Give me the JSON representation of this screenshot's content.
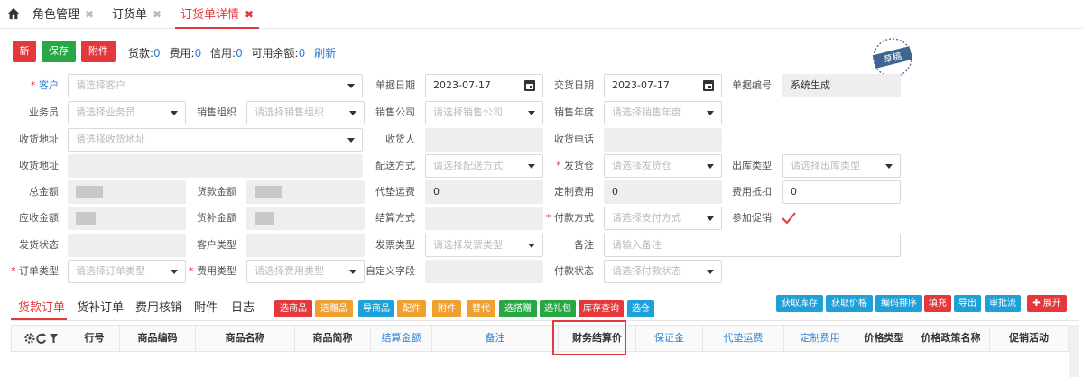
{
  "tabs": [
    {
      "label": "角色管理",
      "close": "✖",
      "active": false
    },
    {
      "label": "订货单",
      "close": "✖",
      "active": false
    },
    {
      "label": "订货单详情",
      "close": "✖",
      "active": true
    }
  ],
  "toolbar": {
    "new_label": "新",
    "save_label": "保存",
    "attach_label": "附件",
    "goods_label": "货款:",
    "goods_value": "0",
    "fee_label": "费用:",
    "fee_value": "0",
    "credit_label": "信用:",
    "credit_value": "0",
    "balance_label": "可用余额:",
    "balance_value": "0",
    "refresh_label": "刷新"
  },
  "stamp": {
    "text": "草稿"
  },
  "form": {
    "customer_label": "客户",
    "customer_ph": "请选择客户",
    "order_date_label": "单据日期",
    "order_date": "2023-07-17",
    "delivery_date_label": "交货日期",
    "delivery_date": "2023-07-17",
    "order_no_label": "单据编号",
    "order_no": "系统生成",
    "salesman_label": "业务员",
    "salesman_ph": "请选择业务员",
    "sales_org_label": "销售组织",
    "sales_org_ph": "请选择销售组织",
    "sales_company_label": "销售公司",
    "sales_company_ph": "请选择销售公司",
    "sales_year_label": "销售年度",
    "sales_year_ph": "请选择销售年度",
    "ship_addr_label": "收货地址",
    "ship_addr_ph": "请选择收货地址",
    "receiver_label": "收货人",
    "receiver_phone_label": "收货电话",
    "ship_addr2_label": "收货地址",
    "delivery_method_label": "配送方式",
    "delivery_method_ph": "请选择配送方式",
    "warehouse_label": "发货仓",
    "warehouse_ph": "请选择发货仓",
    "outbound_type_label": "出库类型",
    "outbound_type_ph": "请选择出库类型",
    "total_label": "总金额",
    "goods_amount_label": "货款金额",
    "advance_freight_label": "代垫运费",
    "advance_freight": "0",
    "custom_fee_label": "定制费用",
    "custom_fee": "0",
    "fee_offset_label": "费用抵扣",
    "fee_offset": "0",
    "receivable_label": "应收金额",
    "supplement_label": "货补金额",
    "settle_method_label": "结算方式",
    "pay_method_label": "付款方式",
    "pay_method_ph": "请选择支付方式",
    "promo_label": "参加促销",
    "ship_status_label": "发货状态",
    "customer_type_label": "客户类型",
    "invoice_type_label": "发票类型",
    "invoice_type_ph": "请选择发票类型",
    "remark_label": "备注",
    "remark_ph": "请输入备注",
    "order_type_label": "订单类型",
    "order_type_ph": "请选择订单类型",
    "fee_type_label": "费用类型",
    "fee_type_ph": "请选择费用类型",
    "custom_field_label": "自定义字段",
    "pay_status_label": "付款状态",
    "pay_status_ph": "请选择付款状态"
  },
  "detail_tabs": [
    "货款订单",
    "货补订单",
    "费用核销",
    "附件",
    "日志"
  ],
  "detail_buttons_left": [
    {
      "label": "选商品",
      "color": "red"
    },
    {
      "label": "选赠品",
      "color": "orange"
    },
    {
      "label": "导商品",
      "color": "blue"
    },
    {
      "label": "配件",
      "color": "orange"
    },
    {
      "label": "附件",
      "color": "orange"
    },
    {
      "label": "替代",
      "color": "orange"
    },
    {
      "label": "选搭赠",
      "color": "green"
    },
    {
      "label": "选礼包",
      "color": "green"
    },
    {
      "label": "库存查询",
      "color": "red"
    },
    {
      "label": "选仓",
      "color": "blue"
    }
  ],
  "detail_buttons_right": [
    {
      "label": "获取库存",
      "color": "blue"
    },
    {
      "label": "获取价格",
      "color": "blue"
    },
    {
      "label": "编码排序",
      "color": "blue"
    },
    {
      "label": "填充",
      "color": "red"
    },
    {
      "label": "导出",
      "color": "blue"
    },
    {
      "label": "审批流",
      "color": "blue"
    }
  ],
  "expand_label": "展开",
  "table": {
    "columns": [
      "行号",
      "商品编码",
      "商品名称",
      "商品简称",
      "结算金额",
      "备注",
      "财务结算价",
      "保证金",
      "代垫运费",
      "定制费用",
      "价格类型",
      "价格政策名称",
      "促销活动"
    ]
  },
  "colors": {
    "accent": "#e4393c",
    "link": "#2f7fd1",
    "green": "#27a844",
    "orange": "#f0a030",
    "blue": "#1ea0d8"
  }
}
